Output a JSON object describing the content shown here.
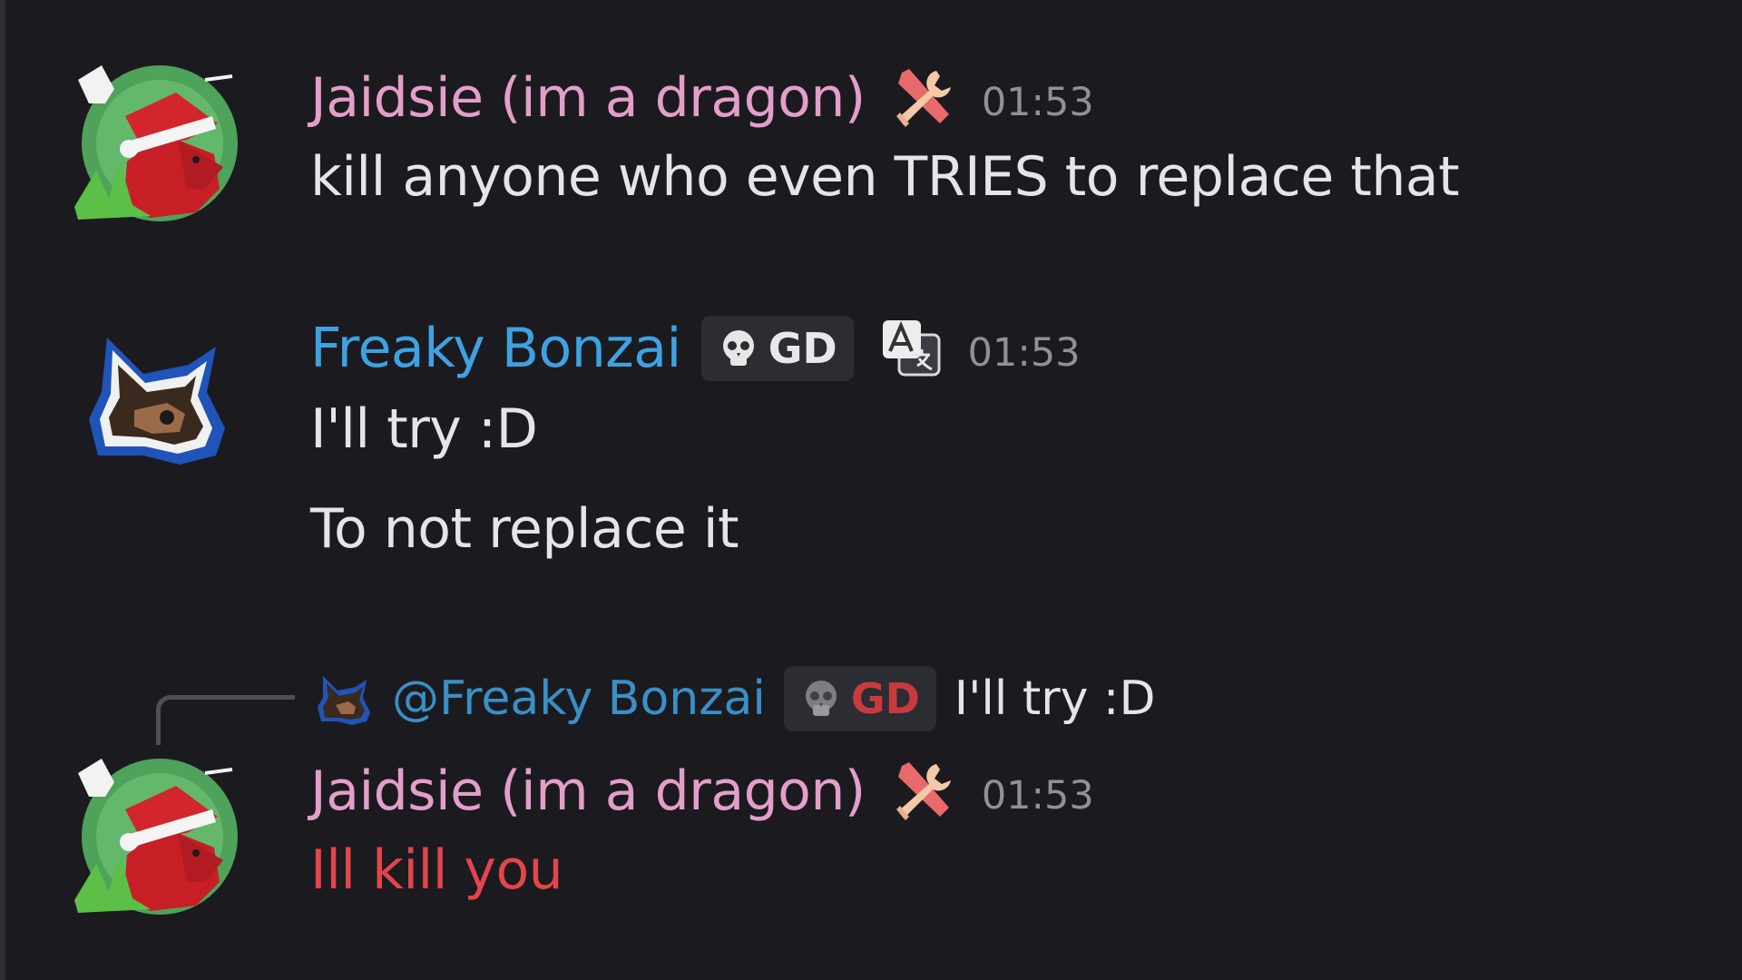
{
  "messages": [
    {
      "author": "Jaidsie (im a dragon)",
      "author_color": "#e49ec9",
      "role_icon": "tools-icon",
      "timestamp": "01:53",
      "lines": [
        "kill anyone who even TRIES to replace that"
      ]
    },
    {
      "author": "Freaky Bonzai",
      "author_color": "#3ea2e2",
      "tag": "GD",
      "tag_icon": "skull-icon",
      "extra_icon": "translate-icon",
      "timestamp": "01:53",
      "lines": [
        "I'll try :D",
        "To not replace it"
      ]
    },
    {
      "reply": {
        "mention": "@Freaky Bonzai",
        "tag": "GD",
        "tag_color": "#c93a3f",
        "content": "I'll try :D"
      },
      "author": "Jaidsie (im a dragon)",
      "author_color": "#e49ec9",
      "role_icon": "tools-icon",
      "timestamp": "01:53",
      "lines": [
        "Ill kill you"
      ],
      "text_color": "#e2454b"
    }
  ]
}
